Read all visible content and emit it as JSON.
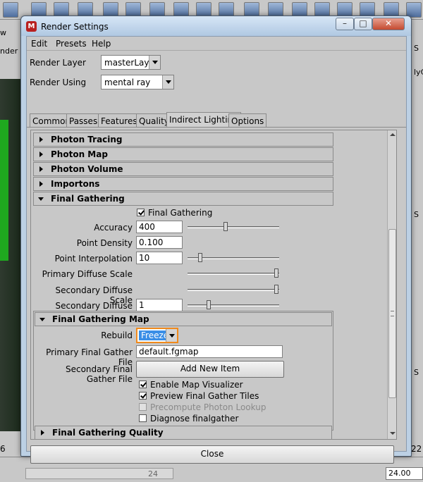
{
  "background": {
    "left_labels": [
      "w",
      "nder"
    ],
    "right_labels": [
      "S",
      "lyC",
      "S",
      "S"
    ],
    "bottom_left": "6",
    "bottom_right": "22",
    "range_end": "24",
    "current_time": "24.00"
  },
  "window": {
    "title": "Render Settings",
    "icon": "maya-icon",
    "controls": {
      "minimize": "–",
      "maximize": "□",
      "close": "✕"
    }
  },
  "menubar": {
    "items": [
      "Edit",
      "Presets",
      "Help"
    ]
  },
  "render_layer": {
    "label": "Render Layer",
    "value": "masterLayer"
  },
  "render_using": {
    "label": "Render Using",
    "value": "mental ray"
  },
  "tabs": [
    "Common",
    "Passes",
    "Features",
    "Quality",
    "Indirect Lighting",
    "Options"
  ],
  "active_tab": "Indirect Lighting",
  "sections": {
    "photon_tracing": "Photon Tracing",
    "photon_map": "Photon Map",
    "photon_volume": "Photon Volume",
    "importons": "Importons",
    "final_gathering": "Final Gathering",
    "final_gathering_map": "Final Gathering Map",
    "final_gathering_quality": "Final Gathering Quality"
  },
  "final_gathering": {
    "enable_label": "Final Gathering",
    "enable_checked": true,
    "accuracy": {
      "label": "Accuracy",
      "value": "400",
      "slider": 0.4
    },
    "point_density": {
      "label": "Point Density",
      "value": "0.100"
    },
    "point_interpolation": {
      "label": "Point Interpolation",
      "value": "10",
      "slider": 0.13
    },
    "primary_diffuse_scale": {
      "label": "Primary Diffuse Scale",
      "slider": 1.0
    },
    "secondary_diffuse_scale": {
      "label": "Secondary Diffuse Scale",
      "slider": 1.0
    },
    "secondary_diffuse_bounces": {
      "label": "Secondary Diffuse Bounces",
      "value": "1",
      "slider": 0.22
    }
  },
  "fg_map": {
    "rebuild": {
      "label": "Rebuild",
      "value": "Freeze"
    },
    "primary_file": {
      "label": "Primary Final Gather File",
      "value": "default.fgmap"
    },
    "secondary_file": {
      "label": "Secondary Final Gather File",
      "button": "Add New Item"
    },
    "checkboxes": [
      {
        "label": "Enable Map Visualizer",
        "checked": true,
        "disabled": false
      },
      {
        "label": "Preview Final Gather Tiles",
        "checked": true,
        "disabled": false
      },
      {
        "label": "Precompute Photon Lookup",
        "checked": false,
        "disabled": true
      },
      {
        "label": "Diagnose finalgather",
        "checked": false,
        "disabled": false
      }
    ]
  },
  "close_button": "Close",
  "colors": {
    "highlight": "#f08a1c",
    "selection": "#3a8ee6",
    "panel": "#c8c8c8",
    "titlebar": "#bcd0e4"
  }
}
